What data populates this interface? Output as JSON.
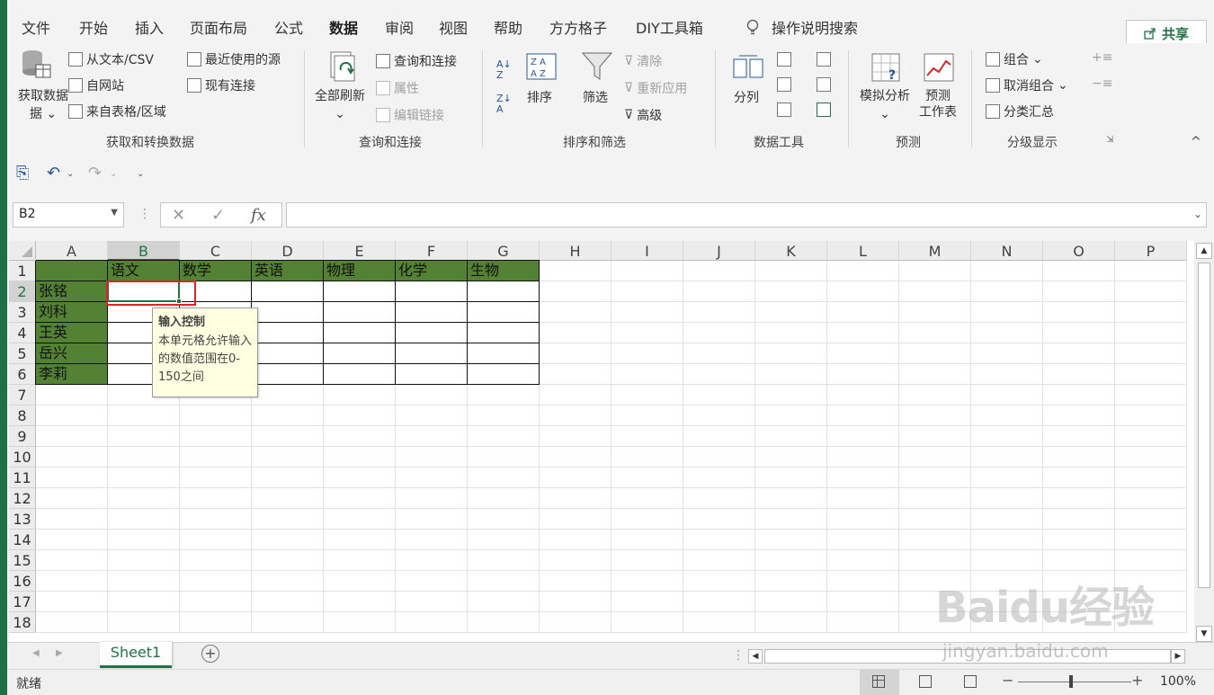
{
  "tabs": [
    "文件",
    "开始",
    "插入",
    "页面布局",
    "公式",
    "数据",
    "审阅",
    "视图",
    "帮助",
    "方方格子",
    "DIY工具箱"
  ],
  "active_tab": "数据",
  "search": "操作说明搜索",
  "share": "共享",
  "ribbon": {
    "get_data": {
      "big_label": "获取数据",
      "from_text": "从文本/CSV",
      "from_web": "自网站",
      "from_table": "来自表格/区域",
      "recent": "最近使用的源",
      "existing": "现有连接",
      "group": "获取和转换数据"
    },
    "queries": {
      "refresh_all": "全部刷新",
      "queries_conn": "查询和连接",
      "properties": "属性",
      "edit_links": "编辑链接",
      "group": "查询和连接"
    },
    "sort_filter": {
      "sort": "排序",
      "filter": "筛选",
      "clear": "清除",
      "reapply": "重新应用",
      "advanced": "高级",
      "group": "排序和筛选"
    },
    "data_tools": {
      "text_to_columns": "分列",
      "group": "数据工具"
    },
    "forecast": {
      "what_if": "模拟分析",
      "forecast_sheet": "预测\n工作表",
      "group": "预测"
    },
    "outline": {
      "group_btn": "组合",
      "ungroup": "取消组合",
      "subtotal": "分类汇总",
      "group": "分级显示"
    }
  },
  "namebox": "B2",
  "fx": "fx",
  "columns": [
    "A",
    "B",
    "C",
    "D",
    "E",
    "F",
    "G",
    "H",
    "I",
    "J",
    "K",
    "L",
    "M",
    "N",
    "O",
    "P"
  ],
  "rows": [
    "1",
    "2",
    "3",
    "4",
    "5",
    "6",
    "7",
    "8",
    "9",
    "10",
    "11",
    "12",
    "13",
    "14",
    "15",
    "16",
    "17",
    "18"
  ],
  "header_row": [
    "语文",
    "数学",
    "英语",
    "物理",
    "化学",
    "生物"
  ],
  "names": [
    "张铭",
    "刘科",
    "王英",
    "岳兴",
    "李莉"
  ],
  "tooltip": {
    "title": "输入控制",
    "body": "本单元格允许输入的数值范围在0-150之间"
  },
  "sheet": "Sheet1",
  "status": "就绪",
  "zoom": "100%",
  "watermark": "Baidu经验",
  "watermark_url": "jingyan.baidu.com",
  "colors": {
    "excel_green": "#217346",
    "table_green": "#548235",
    "selection_red": "#d7262a"
  }
}
